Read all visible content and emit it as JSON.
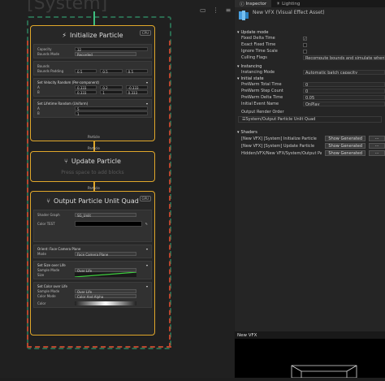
{
  "graph": {
    "ghost_title": "[System]",
    "init": {
      "title": "Initialize Particle",
      "badge": "CPU",
      "rows": [
        {
          "k": "Capacity",
          "v": "32"
        },
        {
          "k": "Bounds Mode",
          "v": "Recorded"
        }
      ],
      "bounds_label": "Bounds",
      "padding_label": "Bounds Padding",
      "padding_vals": [
        "0.5",
        "0.5",
        "0.5"
      ],
      "vel_title": "Set Velocity Random (Per-component)",
      "vel_rows": [
        {
          "k": "A",
          "v": [
            "0.333",
            "0.2",
            "-0.333"
          ]
        },
        {
          "k": "B",
          "v": [
            "0.333",
            "1",
            "0.333"
          ]
        }
      ],
      "life_title": "Set Lifetime Random (Uniform)",
      "life_rows": [
        {
          "k": "A",
          "v": "5"
        },
        {
          "k": "B",
          "v": "1"
        }
      ],
      "flow_out": "Particle"
    },
    "update": {
      "title": "Update Particle",
      "placeholder": "Press space to add blocks",
      "flow_in": "Particle"
    },
    "output": {
      "title": "Output Particle Unlit Quad",
      "badge": "GPU",
      "flow_in": "Particle",
      "rows": [
        {
          "k": "Shader Graph",
          "v": "SG_Unlit"
        },
        {
          "k": "Color TEST",
          "v": ""
        }
      ],
      "orient_title": "Orient: Face Camera Plane",
      "orient_rows": [
        {
          "k": "Mode",
          "v": "Face Camera Plane"
        }
      ],
      "size_title": "Set Size over Life",
      "size_rows": [
        {
          "k": "Sample Mode",
          "v": "Over Life"
        },
        {
          "k": "Size",
          "v": ""
        }
      ],
      "color_title": "Set Color over Life",
      "color_rows": [
        {
          "k": "Sample Mode",
          "v": "Over Life"
        },
        {
          "k": "Color Mode",
          "v": "Color And Alpha"
        },
        {
          "k": "Color",
          "v": ""
        }
      ]
    }
  },
  "inspector": {
    "tabs": [
      "Inspector",
      "Lighting"
    ],
    "asset_title": "New VFX (Visual Effect Asset)",
    "update_mode": {
      "title": "Update mode",
      "rows": [
        {
          "k": "Fixed Delta Time",
          "v": "✓"
        },
        {
          "k": "Exact Fixed Time",
          "v": ""
        },
        {
          "k": "Ignore Time Scale",
          "v": ""
        },
        {
          "k": "Culling Flags",
          "v": "Recompute bounds and simulate when visible"
        }
      ]
    },
    "instancing": {
      "title": "Instancing",
      "rows": [
        {
          "k": "Instancing Mode",
          "v": "Automatic batch capacity"
        }
      ]
    },
    "initial_state": {
      "title": "Initial state",
      "rows": [
        {
          "k": "PreWarm Total Time",
          "v": "0"
        },
        {
          "k": "PreWarm Step Count",
          "v": "0"
        },
        {
          "k": "PreWarm Delta Time",
          "v": "0.05"
        },
        {
          "k": "Initial Event Name",
          "v": "OnPlay"
        }
      ]
    },
    "render_order": {
      "title": "Output Render Order",
      "item": "System/Output Particle Unlit Quad"
    },
    "shaders": {
      "title": "Shaders",
      "rows": [
        {
          "k": "[New VFX] [System] Initialize Particle",
          "btn": "Show Generated",
          "btn2": "..."
        },
        {
          "k": "[New VFX] [System] Update Particle",
          "btn": "Show Generated",
          "btn2": "..."
        },
        {
          "k": "Hidden/VFX/New VFX/System/Output Particle Unlit Quad",
          "btn": "Show Generated",
          "btn2": "..."
        }
      ]
    },
    "preview_title": "New VFX"
  },
  "colors": {
    "context_border": "#e0a72a",
    "system_border": "#2b6b50",
    "dashed_red": "#b8462e"
  }
}
